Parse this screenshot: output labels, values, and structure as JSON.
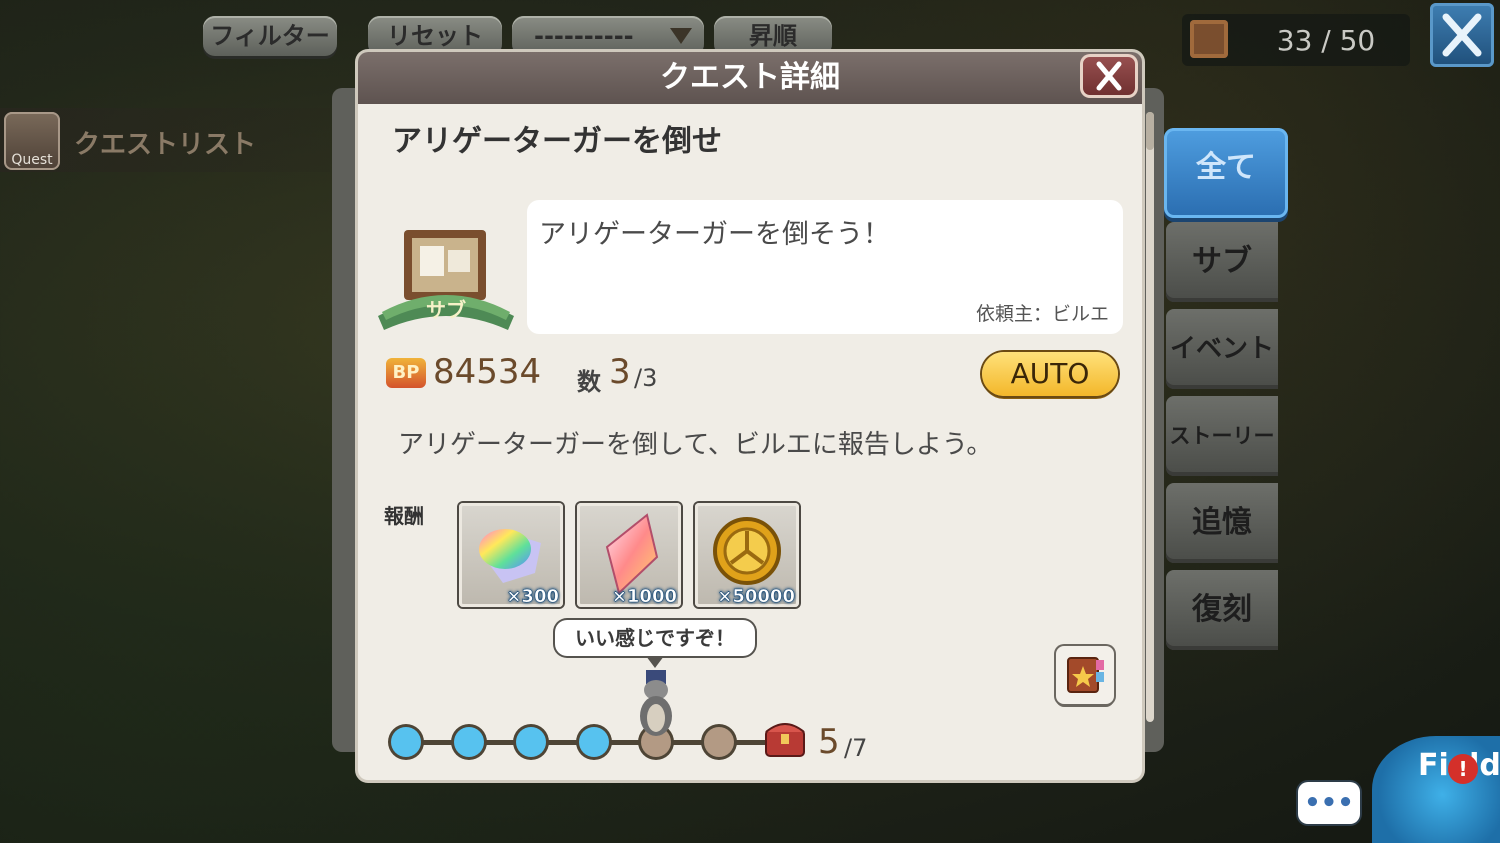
{
  "topbar": {
    "filter_label": "フィルター",
    "reset_label": "リセット",
    "sort_select_value": "----------",
    "order_label": "昇順",
    "quest_count": "33 / 50"
  },
  "sidebar": {
    "quest_icon_label": "Quest",
    "quest_list_label": "クエストリスト"
  },
  "tabs": [
    {
      "label": "全て",
      "active": true
    },
    {
      "label": "サブ"
    },
    {
      "label": "イベント"
    },
    {
      "label": "ストーリー"
    },
    {
      "label": "追憶"
    },
    {
      "label": "復刻"
    }
  ],
  "dialog": {
    "header_title": "クエスト詳細",
    "quest_title": "アリゲーターガーを倒せ",
    "category_ribbon": "サブ",
    "description": "アリゲーターガーを倒そう！",
    "client": "依頼主：ビルエ",
    "bp_badge": "BP",
    "bp_value": "84534",
    "count_label": "数",
    "count_current": "3",
    "count_total": "/3",
    "auto_label": "AUTO",
    "objective": "アリゲーターガーを倒して、ビルエに報告しよう。",
    "rewards_label": "報酬",
    "rewards": [
      {
        "icon": "rainbow-gem-icon",
        "count": "×300"
      },
      {
        "icon": "crystal-icon",
        "count": "×1000"
      },
      {
        "icon": "gold-coin-icon",
        "count": "×50000"
      }
    ],
    "speech_bubble": "いい感じですぞ！",
    "progress": {
      "current": "5",
      "total": "/7",
      "done": 4,
      "steps": 6
    }
  },
  "field_label": "Field",
  "colors": {
    "accent_blue": "#4f9ee0",
    "progress_done": "#57c2ef",
    "auto_yellow": "#f3b72a"
  }
}
